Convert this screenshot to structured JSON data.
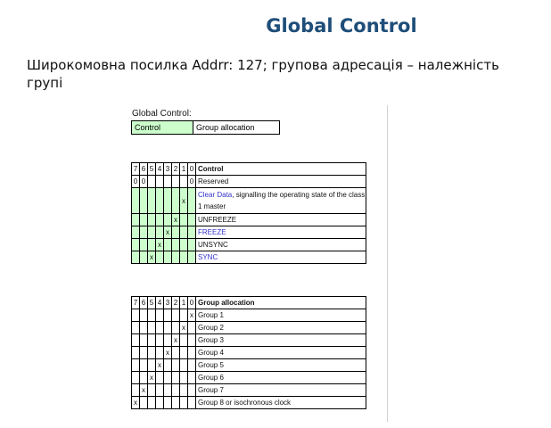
{
  "slide": {
    "title": "Global Control",
    "subtitle": "Широкомовна посилка Addrr: 127; групова адресація – належність групі"
  },
  "doc": {
    "heading": "Global Control:",
    "summary_cells": [
      "Control",
      "Group allocation"
    ],
    "control_table": {
      "bit_headers": [
        "7",
        "6",
        "5",
        "4",
        "3",
        "2",
        "1",
        "0"
      ],
      "header_label": "Control",
      "rows": [
        {
          "bits": [
            "0",
            "0",
            "",
            "",
            "",
            "",
            "",
            "0"
          ],
          "desc": "Reserved",
          "desc_blue": "",
          "desc_rest": ""
        },
        {
          "bits": [
            "",
            "",
            "",
            "",
            "",
            "",
            "x",
            ""
          ],
          "desc": "",
          "desc_blue": "Clear Data",
          "desc_rest": ", signalling the operating state of the class 1 master"
        },
        {
          "bits": [
            "",
            "",
            "",
            "",
            "",
            "x",
            "",
            ""
          ],
          "desc": "UNFREEZE",
          "desc_blue": "",
          "desc_rest": ""
        },
        {
          "bits": [
            "",
            "",
            "",
            "",
            "x",
            "",
            "",
            ""
          ],
          "desc": "",
          "desc_blue": "FREEZE",
          "desc_rest": ""
        },
        {
          "bits": [
            "",
            "",
            "",
            "x",
            "",
            "",
            "",
            ""
          ],
          "desc": "UNSYNC",
          "desc_blue": "",
          "desc_rest": ""
        },
        {
          "bits": [
            "",
            "",
            "x",
            "",
            "",
            "",
            "",
            ""
          ],
          "desc": "",
          "desc_blue": "SYNC",
          "desc_rest": ""
        }
      ]
    },
    "group_table": {
      "bit_headers": [
        "7",
        "6",
        "5",
        "4",
        "3",
        "2",
        "1",
        "0"
      ],
      "header_label": "Group allocation",
      "rows": [
        {
          "bits": [
            "",
            "",
            "",
            "",
            "",
            "",
            "",
            "x"
          ],
          "desc": "Group 1"
        },
        {
          "bits": [
            "",
            "",
            "",
            "",
            "",
            "",
            "x",
            ""
          ],
          "desc": "Group 2"
        },
        {
          "bits": [
            "",
            "",
            "",
            "",
            "",
            "x",
            "",
            ""
          ],
          "desc": "Group 3"
        },
        {
          "bits": [
            "",
            "",
            "",
            "",
            "x",
            "",
            "",
            ""
          ],
          "desc": "Group 4"
        },
        {
          "bits": [
            "",
            "",
            "",
            "x",
            "",
            "",
            "",
            ""
          ],
          "desc": "Group 5"
        },
        {
          "bits": [
            "",
            "",
            "x",
            "",
            "",
            "",
            "",
            ""
          ],
          "desc": "Group 6"
        },
        {
          "bits": [
            "",
            "x",
            "",
            "",
            "",
            "",
            "",
            ""
          ],
          "desc": "Group 7"
        },
        {
          "bits": [
            "x",
            "",
            "",
            "",
            "",
            "",
            "",
            ""
          ],
          "desc": "Group 8 or isochronous clock"
        }
      ]
    }
  }
}
